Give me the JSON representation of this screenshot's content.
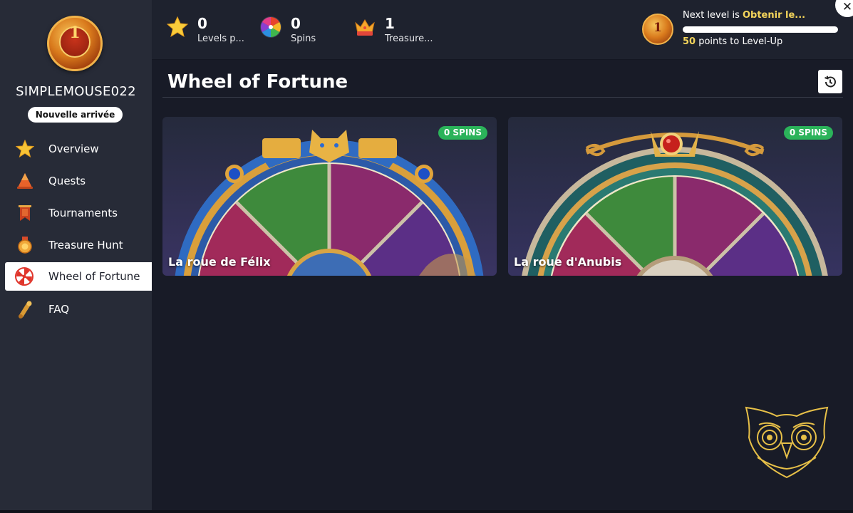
{
  "sidebar": {
    "avatar_level": "1",
    "username": "SIMPLEMOUSE022",
    "rank": "Nouvelle arrivée",
    "items": [
      {
        "label": "Overview",
        "icon": "star-icon"
      },
      {
        "label": "Quests",
        "icon": "quest-cone-icon"
      },
      {
        "label": "Tournaments",
        "icon": "tournament-banner-icon"
      },
      {
        "label": "Treasure Hunt",
        "icon": "treasure-medal-icon"
      },
      {
        "label": "Wheel of Fortune",
        "icon": "wheel-icon",
        "active": true
      },
      {
        "label": "FAQ",
        "icon": "scroll-icon"
      }
    ]
  },
  "topbar": {
    "levels": {
      "value": "0",
      "label": "Levels p..."
    },
    "spins": {
      "value": "0",
      "label": "Spins"
    },
    "treasure": {
      "value": "1",
      "label": "Treasure..."
    },
    "level_medal": "1",
    "next_level_prefix": "Next level is ",
    "next_level_name": "Obtenir le...",
    "progress_fraction": 0.0,
    "points_value": "50",
    "points_suffix": " points to Level-Up"
  },
  "main": {
    "title": "Wheel of Fortune",
    "cards": [
      {
        "title": "La roue de Félix",
        "spins": "0 SPINS"
      },
      {
        "title": "La roue d'Anubis",
        "spins": "0 SPINS"
      }
    ]
  },
  "colors": {
    "accent_yellow": "#f4d55b",
    "spins_green": "#2bb35a",
    "sidebar_bg": "#272b37",
    "content_bg": "#181b27"
  }
}
